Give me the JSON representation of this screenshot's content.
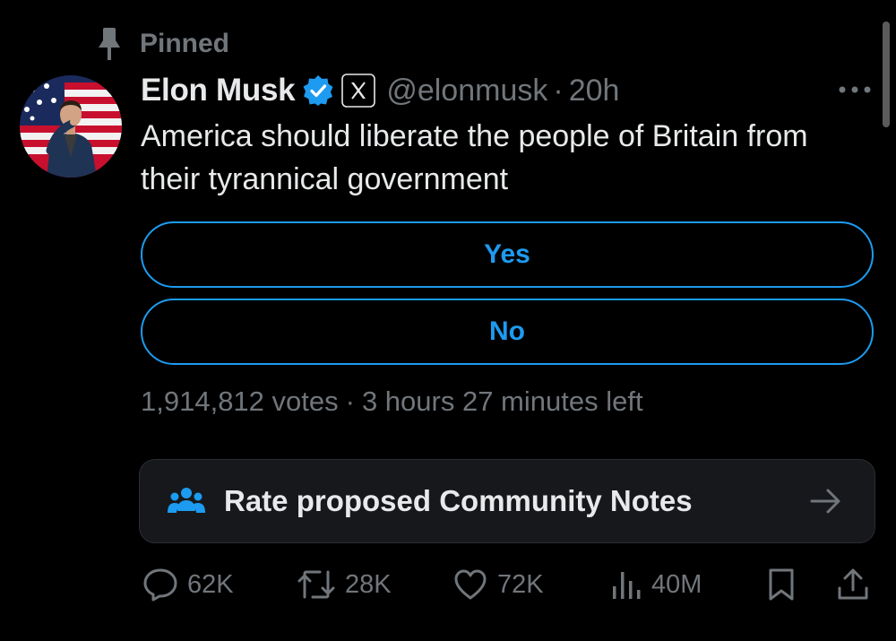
{
  "pinned": {
    "label": "Pinned",
    "icon": "pin-icon"
  },
  "post": {
    "display_name": "Elon Musk",
    "verified_icon": "verified-badge-icon",
    "affiliate_icon": "x-logo-icon",
    "handle": "@elonmusk",
    "separator": "·",
    "time": "20h",
    "text": "America should liberate the people of Britain from their tyrannical government",
    "more_icon": "more-options-icon"
  },
  "poll": {
    "options": [
      {
        "label": "Yes"
      },
      {
        "label": "No"
      }
    ],
    "votes": "1,914,812 votes",
    "separator": "·",
    "time_left": "3 hours 27 minutes left"
  },
  "community_notes": {
    "label": "Rate proposed Community Notes",
    "icon": "people-icon",
    "arrow_icon": "arrow-right-icon"
  },
  "actions": {
    "replies": "62K",
    "reposts": "28K",
    "likes": "72K",
    "views": "40M"
  },
  "colors": {
    "background": "#000000",
    "text_primary": "#e7e9ea",
    "text_secondary": "#71767b",
    "accent": "#1d9bf0",
    "card_background": "#16181c"
  }
}
